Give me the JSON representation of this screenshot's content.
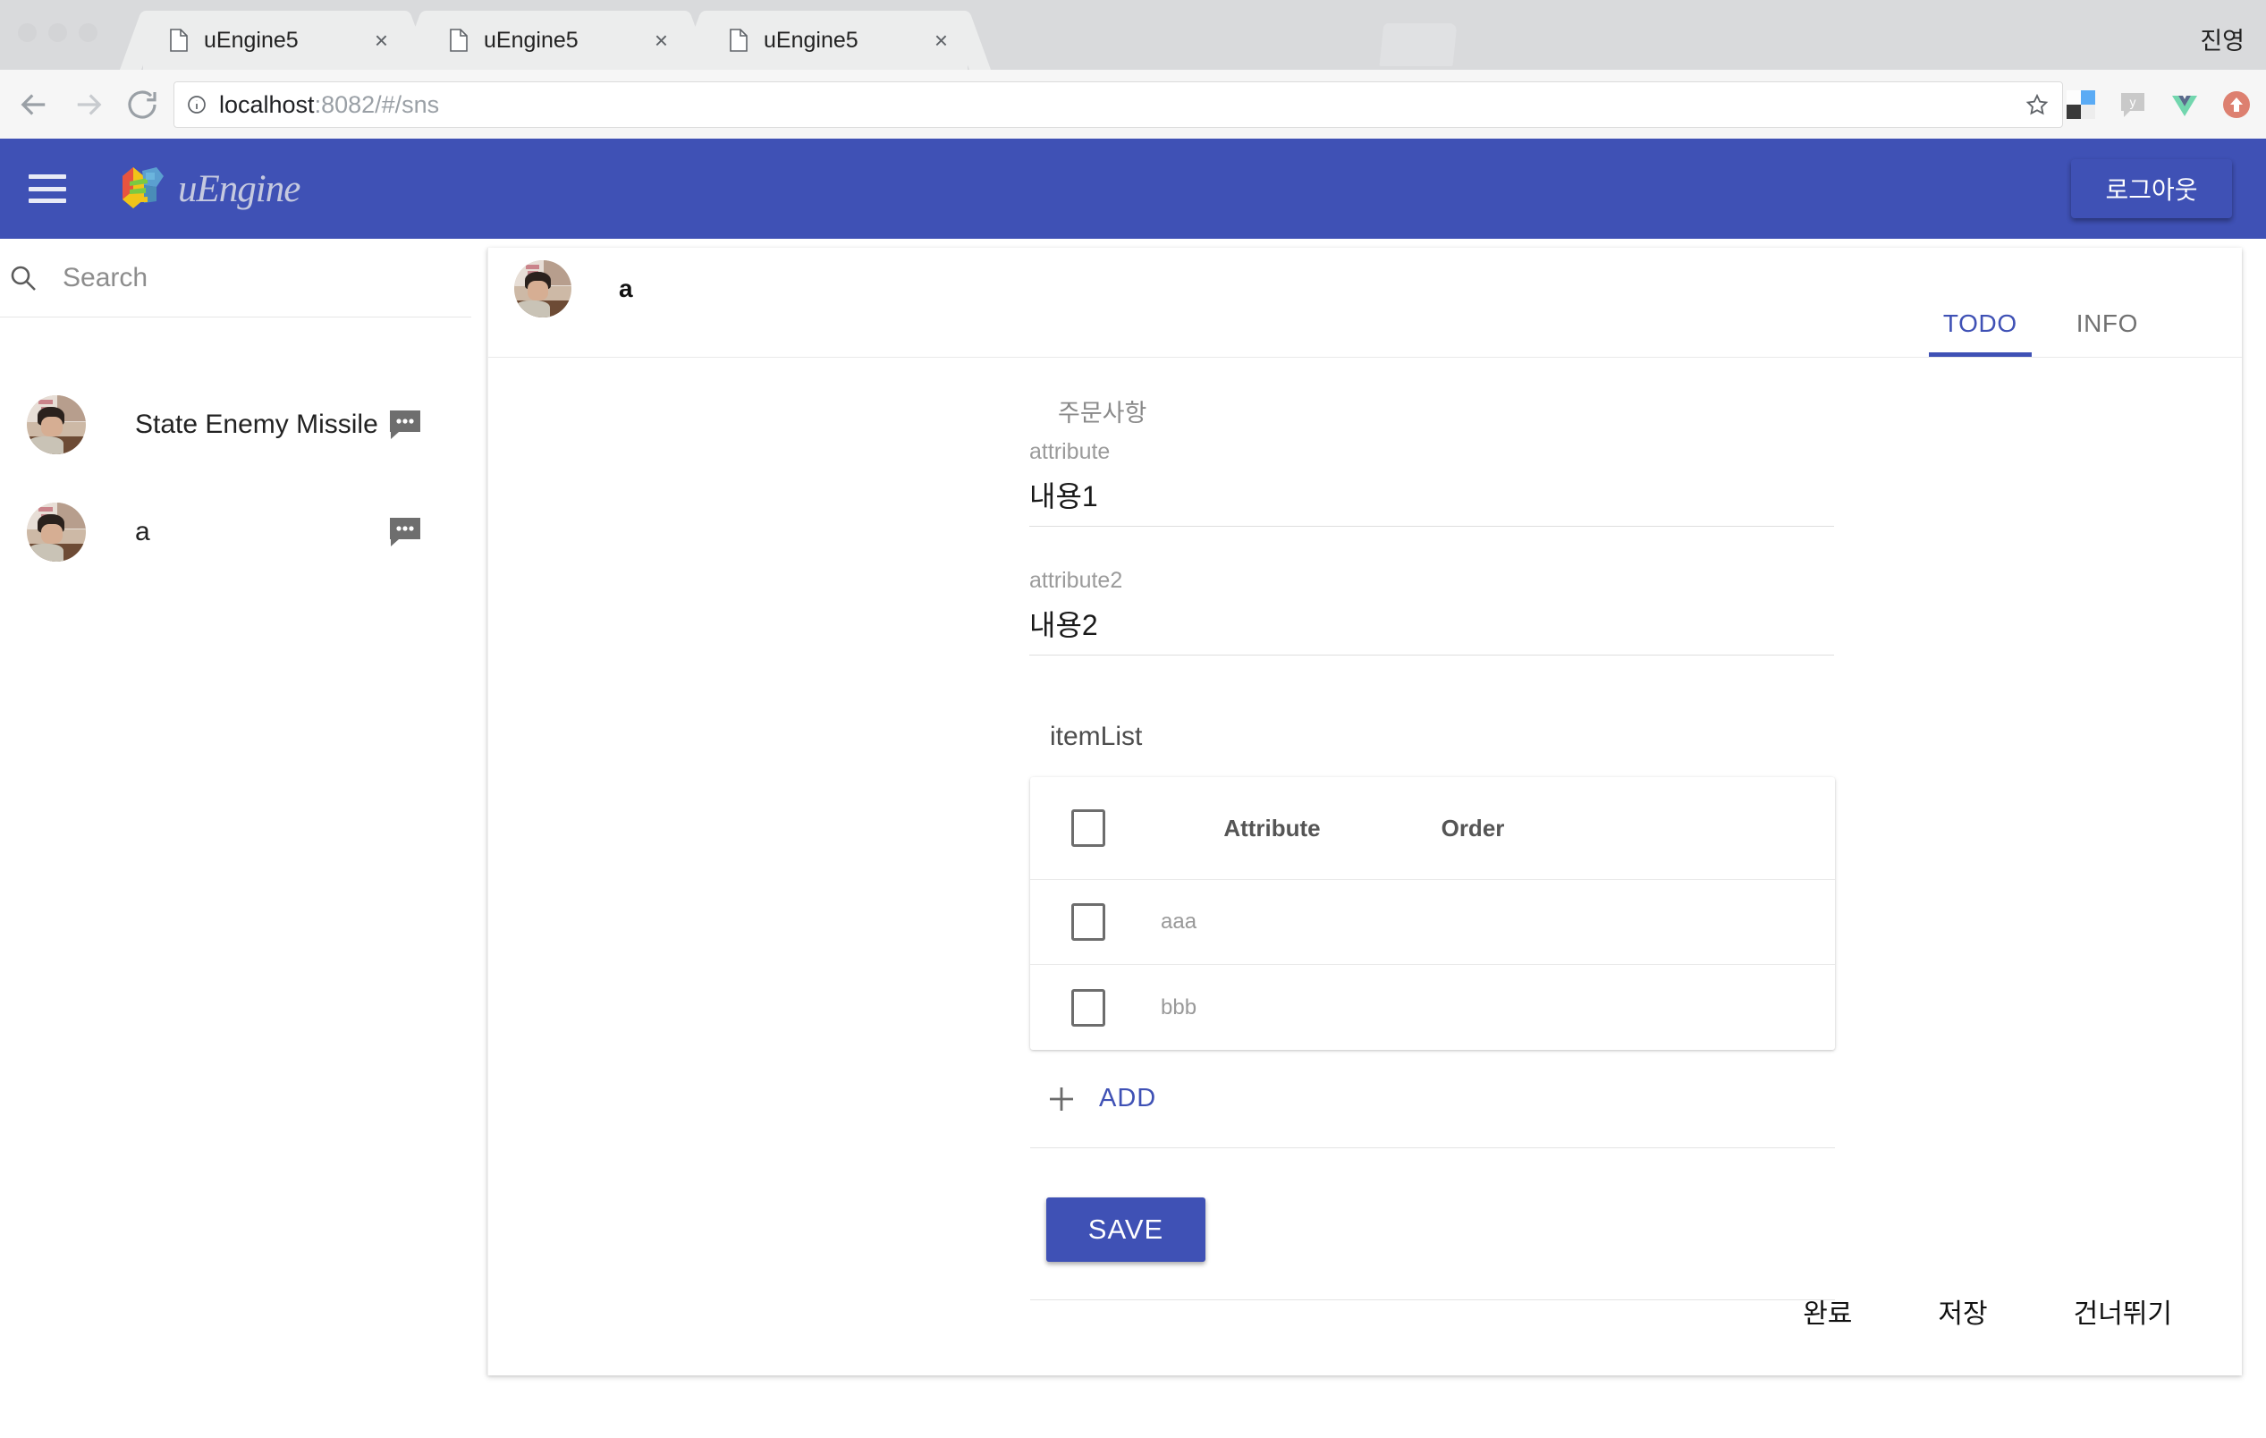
{
  "browser": {
    "tabs": [
      {
        "title": "uEngine5",
        "icon": "document-icon",
        "close": "×"
      },
      {
        "title": "uEngine5",
        "icon": "document-icon",
        "close": "×"
      },
      {
        "title": "uEngine5",
        "icon": "document-icon",
        "close": "×"
      }
    ],
    "profile_name": "진영",
    "url_host": "localhost",
    "url_rest": ":8082/#/sns",
    "nav": {
      "back": "back-arrow-icon",
      "forward": "forward-arrow-icon",
      "reload": "reload-icon"
    },
    "omnibox_icons": {
      "info": "info-icon",
      "bookmark": "star-icon"
    },
    "extensions": [
      "color-swatch-extension-icon",
      "yammer-extension-icon",
      "vue-devtools-extension-icon",
      "upload-extension-icon"
    ]
  },
  "app_header": {
    "menu_icon": "hamburger-menu-icon",
    "brand": "uEngine",
    "logout_label": "로그아웃",
    "accent_color": "#3f51b5"
  },
  "sidebar": {
    "search_placeholder": "Search",
    "search_value": "",
    "contacts": [
      {
        "name": "State Enemy Missile",
        "action_icon": "chat-bubble-icon"
      },
      {
        "name": "a",
        "action_icon": "chat-bubble-icon"
      }
    ]
  },
  "main": {
    "header_title": "a",
    "tabs": [
      {
        "label": "TODO",
        "active": true
      },
      {
        "label": "INFO",
        "active": false
      }
    ],
    "section_title": "주문사항",
    "fields": [
      {
        "label": "attribute",
        "value": "내용1"
      },
      {
        "label": "attribute2",
        "value": "내용2"
      }
    ],
    "list_title": "itemList",
    "table": {
      "columns": [
        "Attribute",
        "Order"
      ],
      "rows": [
        {
          "attribute": "aaa",
          "order": ""
        },
        {
          "attribute": "bbb",
          "order": ""
        }
      ]
    },
    "add_label": "ADD",
    "save_label": "SAVE",
    "footer_actions": [
      "완료",
      "저장",
      "건너뛰기"
    ]
  }
}
